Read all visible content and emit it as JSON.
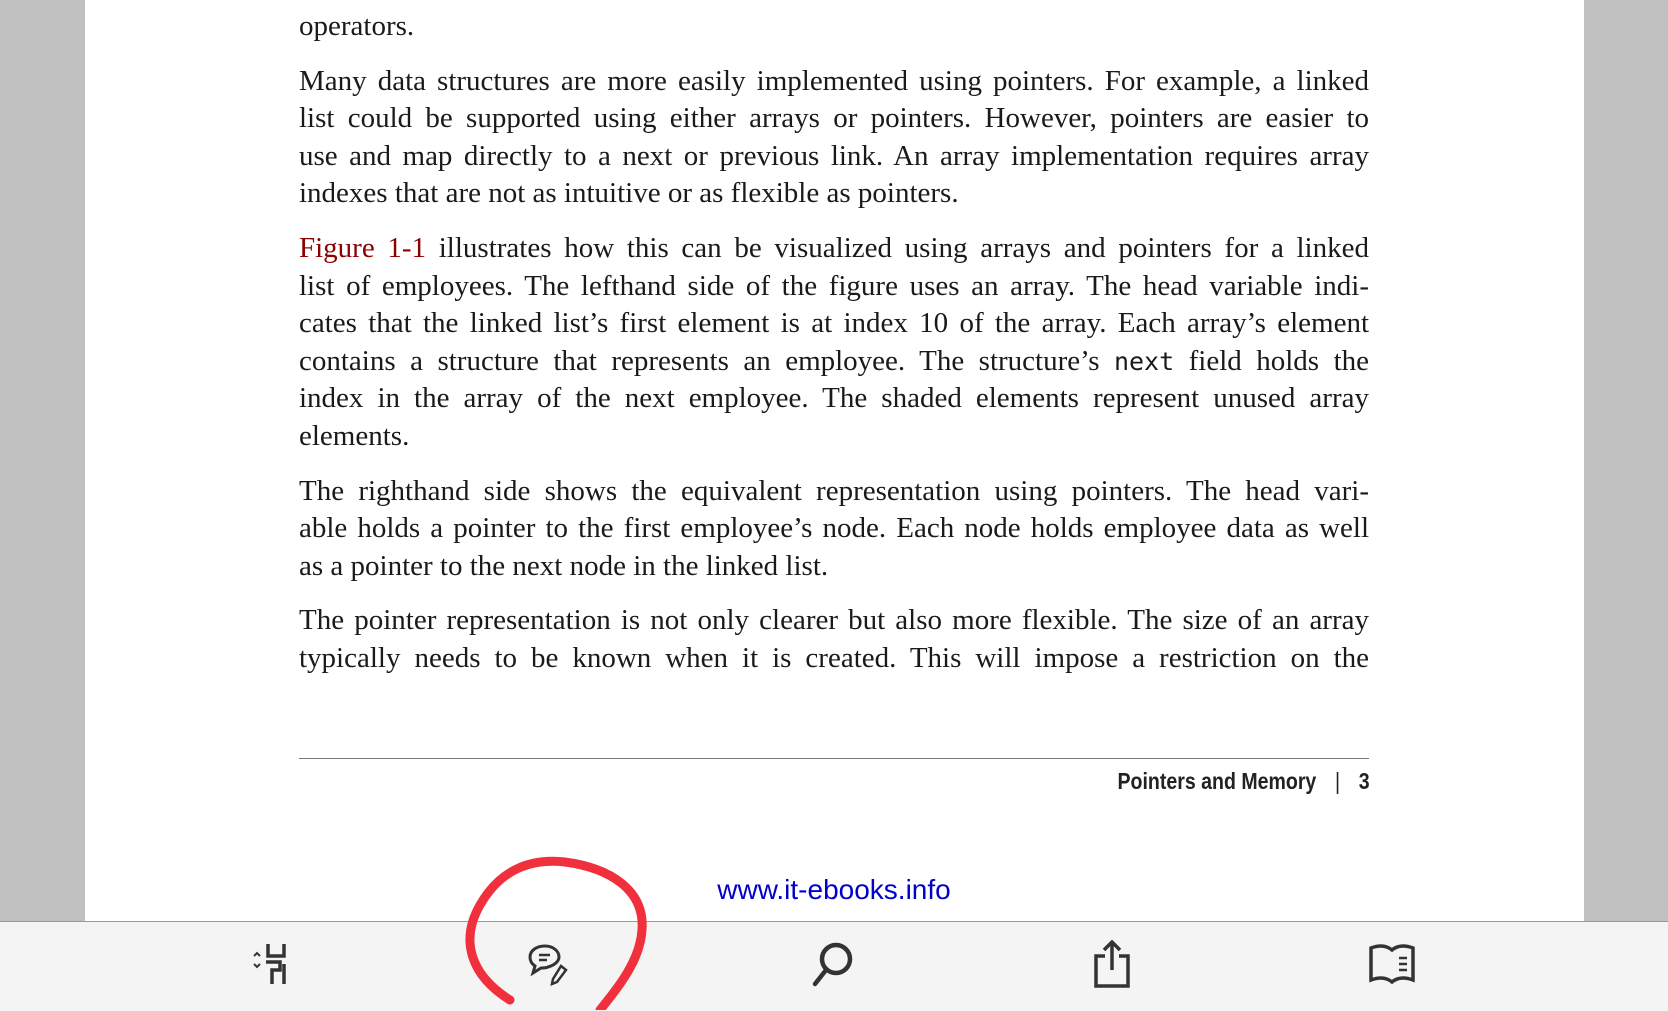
{
  "paragraphs": {
    "p0": [
      "operators."
    ],
    "p1": [
      "Many data structures are more easily implemented using pointers. For example, a linked",
      "list could be supported using either arrays or pointers. However, pointers are easier to",
      "use and map directly to a next or previous link. An array implementation requires array",
      "indexes that are not as intuitive or as flexible as pointers."
    ],
    "p2_link": "Figure 1-1",
    "p2_first": " illustrates how this can be visualized using arrays and pointers for a linked",
    "p2": [
      "list of employees. The lefthand side of the figure uses an array. The head variable indi-",
      "cates that the linked list’s first element is at index 10 of the array. Each array’s element"
    ],
    "p2_code_before": "contains a structure that represents an employee. The structure’s ",
    "p2_code": "next",
    "p2_code_after": " field holds the",
    "p2_rest": [
      "index in the array of the next employee. The shaded elements represent unused array",
      "elements."
    ],
    "p3": [
      "The righthand side shows the equivalent representation using pointers. The head vari-",
      "able holds a pointer to the first employee’s node. Each node holds employee data as well",
      "as a pointer to the next node in the linked list."
    ],
    "p4": [
      "The pointer representation is not only clearer but also more flexible. The size of an array",
      "typically needs to be known when it is created. This will impose a restriction on the"
    ]
  },
  "footer": {
    "chapter": "Pointers and Memory",
    "separator": "|",
    "page": "3"
  },
  "site": "www.it-ebooks.info",
  "toolbar": {
    "icons": [
      "page-layout-icon",
      "comment-edit-icon",
      "search-icon",
      "share-icon",
      "bookmarks-icon"
    ]
  },
  "colors": {
    "link": "#8b0000",
    "site": "#0000cc",
    "annotation": "#f0303c",
    "toolbar": "#f4f4f4",
    "margin": "#c0c0c0"
  }
}
